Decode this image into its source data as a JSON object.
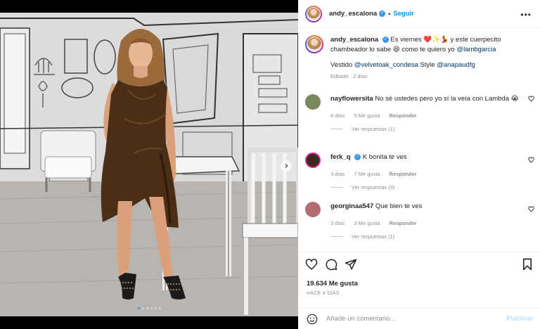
{
  "post": {
    "username": "andy_escalona",
    "follow_label": "Seguir",
    "separator": "•",
    "more_label": "•••",
    "caption": {
      "username": "andy_escalona",
      "text_part1": "Es viernes",
      "emojis": "❤️✨💃",
      "text_part2": "y este cuerpecito chambeador lo sabe",
      "emoji2": "😆",
      "text_part3": "como te quiero yo",
      "mention1": "@lambgarcia",
      "line2_prefix": "Vestido",
      "mention2": "@velvetoak_condesa",
      "line2_mid": "Style",
      "mention3": "@anapaudfg",
      "meta": "Editado · 2 días"
    },
    "comments": [
      {
        "username": "nayflowersita",
        "text": "No sé ustedes pero yo sí la veía con Lambda",
        "emoji": "😭",
        "age": "4 días",
        "likes": "5 Me gusta",
        "reply": "Responder",
        "replies": "Ver respuestas (1)",
        "avatar_color": "#7a8a5e"
      },
      {
        "username": "ferk_q",
        "text": "K bonita te ves",
        "age": "3 días",
        "likes": "7 Me gusta",
        "reply": "Responder",
        "replies": "Ver respuestas (3)",
        "avatar_color": "#3a2a1e"
      },
      {
        "username": "georginaa547",
        "text": "Que bien te ves",
        "age": "3 días",
        "likes": "3 Me gusta",
        "reply": "Responder",
        "replies": "Ver respuestas (1)",
        "avatar_color": "#b56b72"
      }
    ],
    "likes_count": "19.634 Me gusta",
    "posted_ago": "HACE 4 DÍAS",
    "comment_placeholder": "Añade un comentario...",
    "publish_label": "Publicar",
    "carousel": {
      "slides": 6,
      "active_index": 0
    },
    "colors": {
      "accent": "#0095f6",
      "verified": "#3897f0",
      "dress": "#4a2e16",
      "carousel_active": "#2e8bff"
    }
  }
}
